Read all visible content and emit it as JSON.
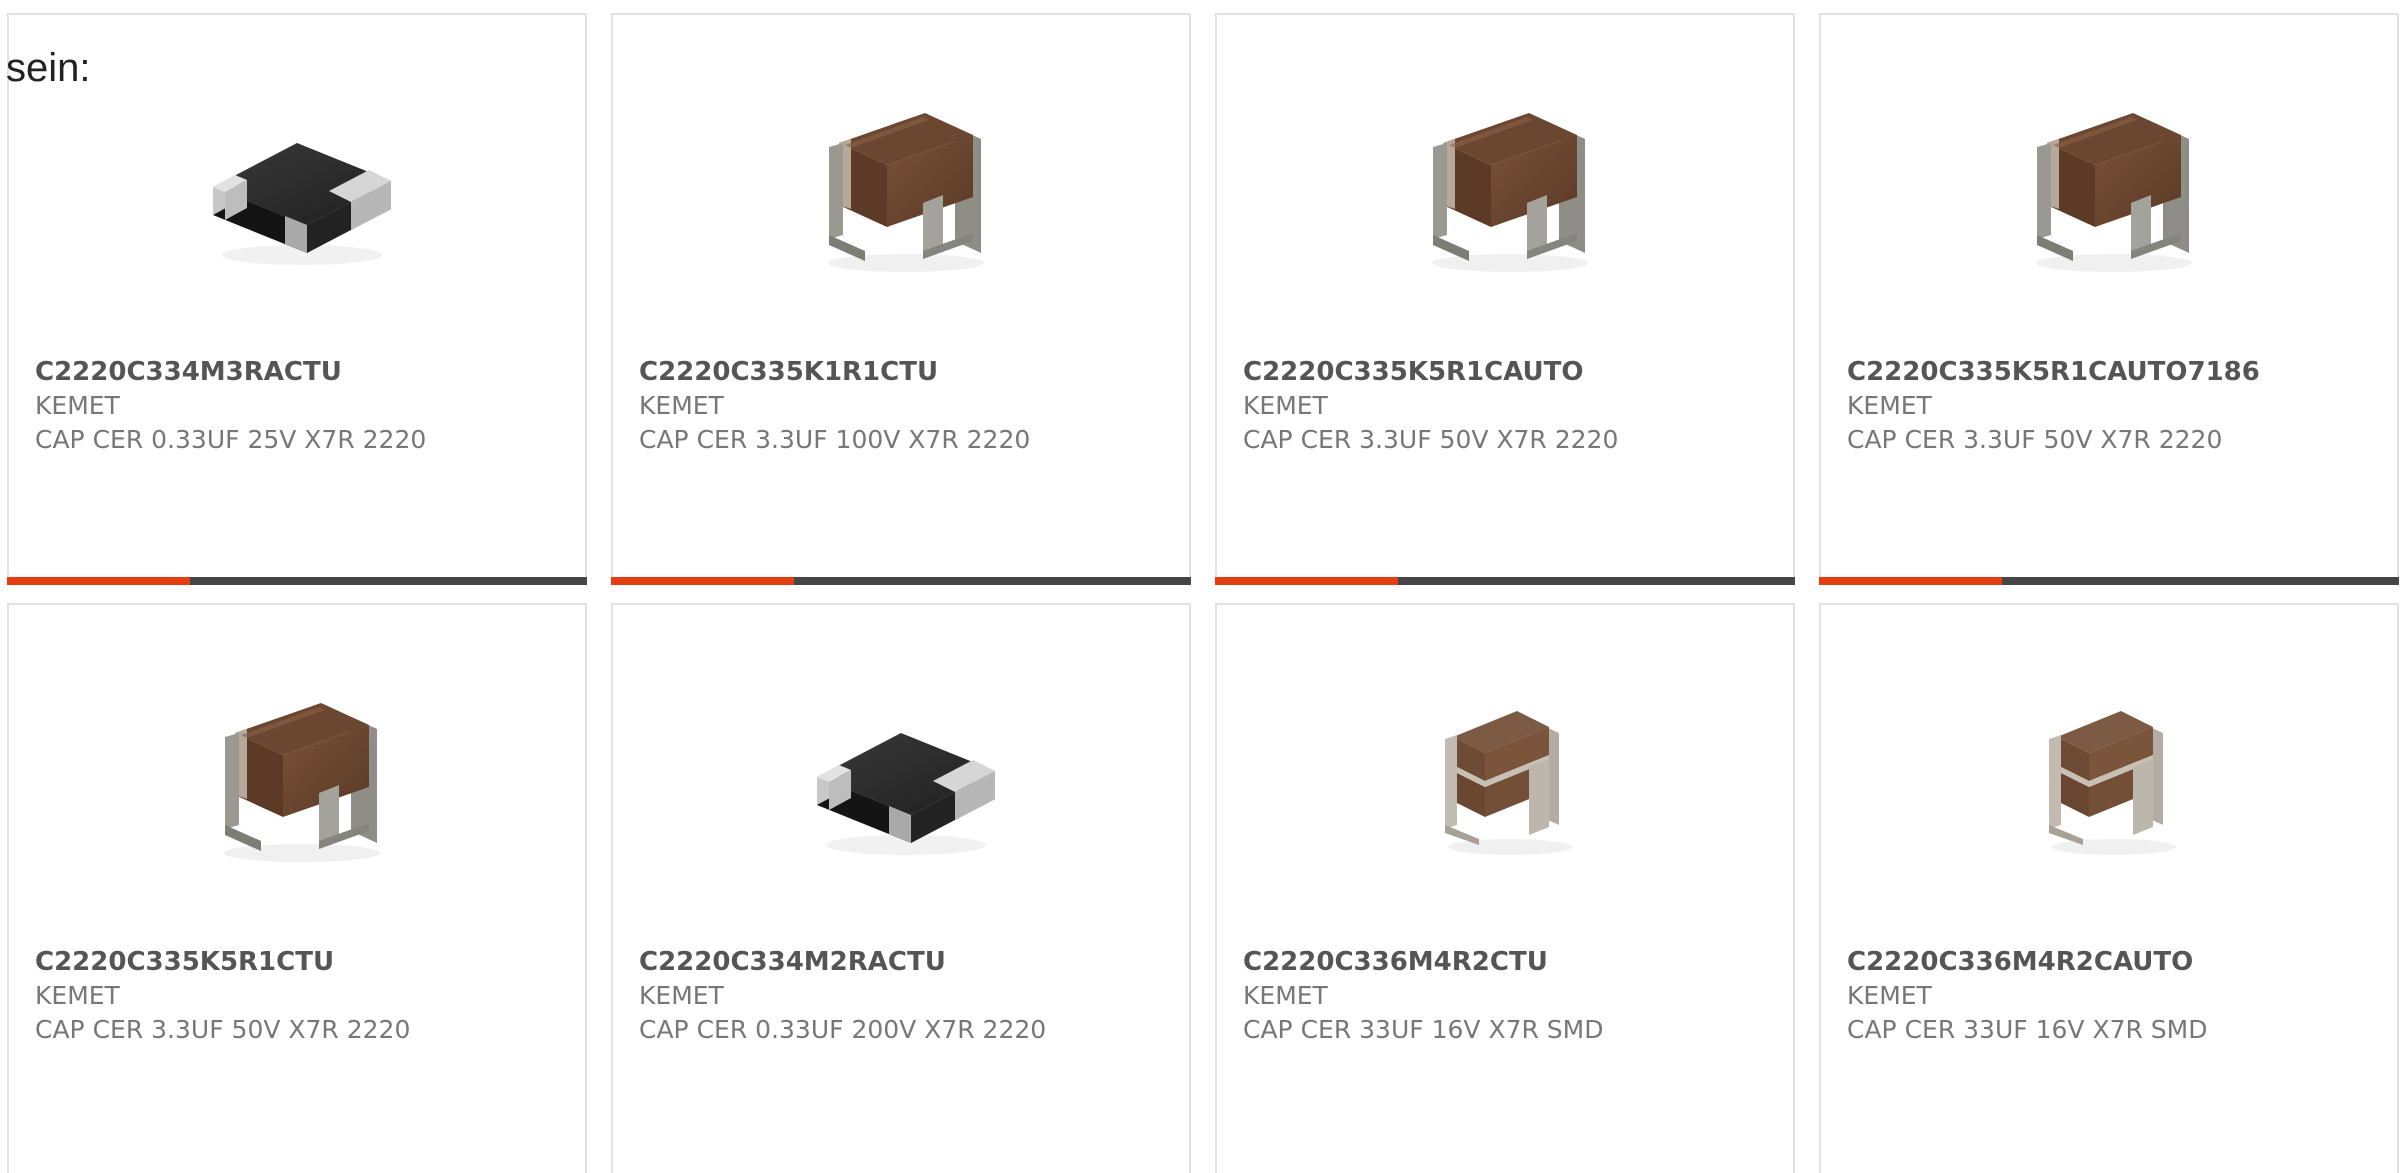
{
  "page": {
    "intro_text": "sein:"
  },
  "colors": {
    "accent": "#e53d12",
    "bar_track": "#464646",
    "card_border": "#e2e2e2",
    "title_text": "#555555",
    "body_text": "#777777"
  },
  "products": [
    {
      "part_number": "C2220C334M3RACTU",
      "manufacturer": "KEMET",
      "description": "CAP CER 0.33UF 25V X7R 2220",
      "image": "flat-chip-icon",
      "progress": 0.315
    },
    {
      "part_number": "C2220C335K1R1CTU",
      "manufacturer": "KEMET",
      "description": "CAP CER 3.3UF 100V X7R 2220",
      "image": "bracket-chip-icon",
      "progress": 0.315
    },
    {
      "part_number": "C2220C335K5R1CAUTO",
      "manufacturer": "KEMET",
      "description": "CAP CER 3.3UF 50V X7R 2220",
      "image": "bracket-chip-icon",
      "progress": 0.315
    },
    {
      "part_number": "C2220C335K5R1CAUTO7186",
      "manufacturer": "KEMET",
      "description": "CAP CER 3.3UF 50V X7R 2220",
      "image": "bracket-chip-icon",
      "progress": 0.315
    },
    {
      "part_number": "C2220C335K5R1CTU",
      "manufacturer": "KEMET",
      "description": "CAP CER 3.3UF 50V X7R 2220",
      "image": "bracket-chip-icon"
    },
    {
      "part_number": "C2220C334M2RACTU",
      "manufacturer": "KEMET",
      "description": "CAP CER 0.33UF 200V X7R 2220",
      "image": "flat-chip-icon"
    },
    {
      "part_number": "C2220C336M4R2CTU",
      "manufacturer": "KEMET",
      "description": "CAP CER 33UF 16V X7R SMD",
      "image": "stacked-chip-icon"
    },
    {
      "part_number": "C2220C336M4R2CAUTO",
      "manufacturer": "KEMET",
      "description": "CAP CER 33UF 16V X7R SMD",
      "image": "stacked-chip-icon"
    }
  ]
}
